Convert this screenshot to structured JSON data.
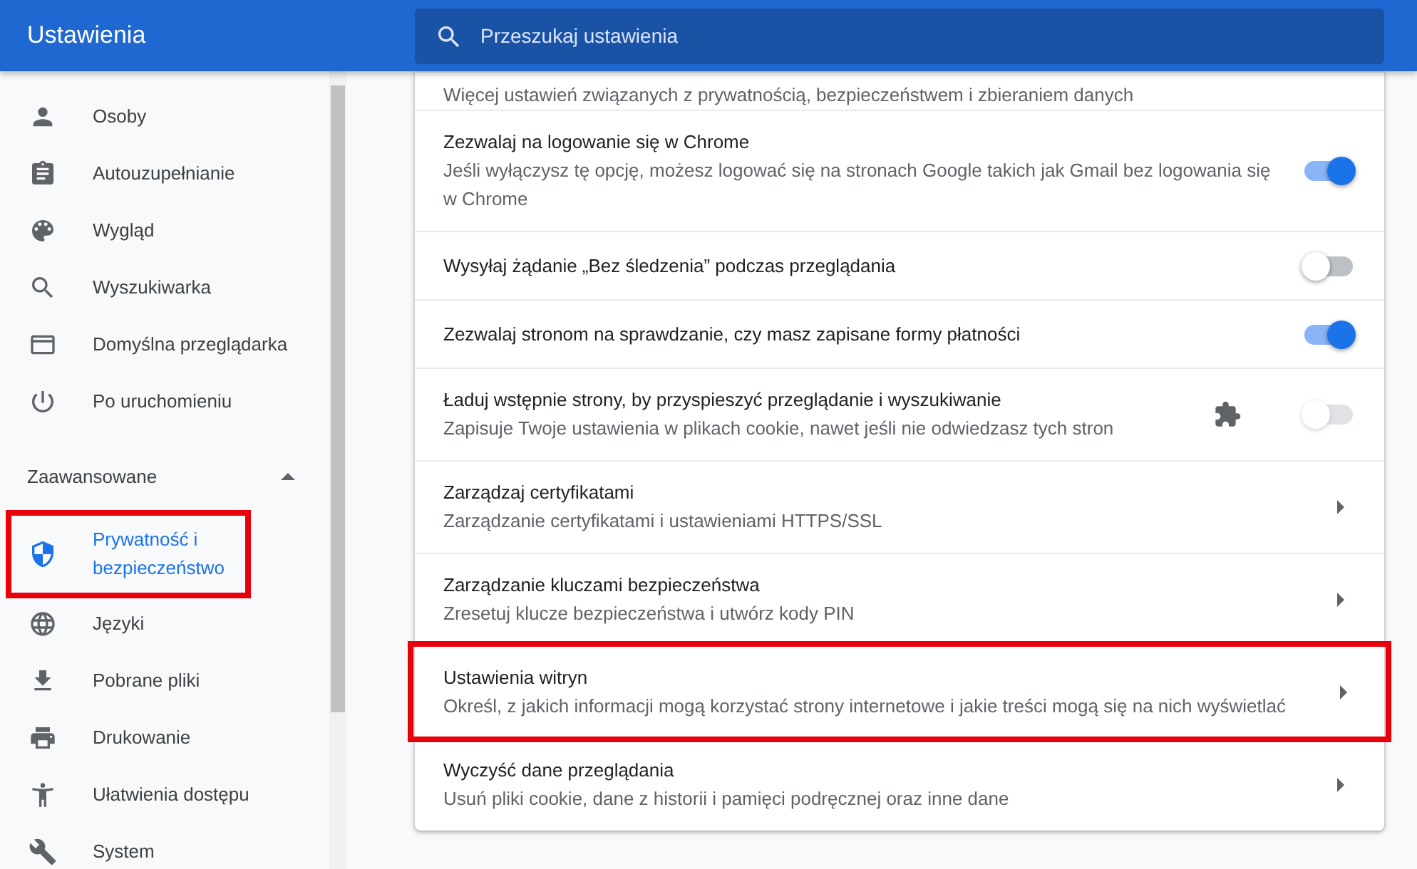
{
  "header": {
    "title": "Ustawienia",
    "search": {
      "placeholder": "Przeszukaj ustawienia"
    }
  },
  "sidebar": {
    "items": [
      {
        "label": "Osoby",
        "selected": false,
        "highlighted": false
      },
      {
        "label": "Autouzupełnianie",
        "selected": false,
        "highlighted": false
      },
      {
        "label": "Wygląd",
        "selected": false,
        "highlighted": false
      },
      {
        "label": "Wyszukiwarka",
        "selected": false,
        "highlighted": false
      },
      {
        "label": "Domyślna przeglądarka",
        "selected": false,
        "highlighted": false
      },
      {
        "label": "Po uruchomieniu",
        "selected": false,
        "highlighted": false
      }
    ],
    "advanced": {
      "label": "Zaawansowane",
      "expanded": true,
      "items": [
        {
          "label": "Prywatność i bezpieczeństwo",
          "selected": true,
          "highlighted": true
        },
        {
          "label": "Języki",
          "selected": false,
          "highlighted": false
        },
        {
          "label": "Pobrane pliki",
          "selected": false,
          "highlighted": false
        },
        {
          "label": "Drukowanie",
          "selected": false,
          "highlighted": false
        },
        {
          "label": "Ułatwienia dostępu",
          "selected": false,
          "highlighted": false
        },
        {
          "label": "System",
          "selected": false,
          "highlighted": false
        }
      ]
    }
  },
  "settings": [
    {
      "kind": "partial",
      "subtitle": "Więcej ustawień związanych z prywatnością, bezpieczeństwem i zbieraniem danych"
    },
    {
      "kind": "toggle",
      "title": "Zezwalaj na logowanie się w Chrome",
      "subtitle": "Jeśli wyłączysz tę opcję, możesz logować się na stronach Google takich jak Gmail bez logowania się w Chrome",
      "on": true,
      "disabled": false,
      "extension": false,
      "highlighted": false
    },
    {
      "kind": "toggle",
      "title": "Wysyłaj żądanie „Bez śledzenia” podczas przeglądania",
      "on": false,
      "disabled": false,
      "extension": false,
      "highlighted": false
    },
    {
      "kind": "toggle",
      "title": "Zezwalaj stronom na sprawdzanie, czy masz zapisane formy płatności",
      "on": true,
      "disabled": false,
      "extension": false,
      "highlighted": false
    },
    {
      "kind": "toggle",
      "title": "Ładuj wstępnie strony, by przyspieszyć przeglądanie i wyszukiwanie",
      "subtitle": "Zapisuje Twoje ustawienia w plikach cookie, nawet jeśli nie odwiedzasz tych stron",
      "on": false,
      "disabled": true,
      "extension": true,
      "highlighted": false
    },
    {
      "kind": "link",
      "title": "Zarządzaj certyfikatami",
      "subtitle": "Zarządzanie certyfikatami i ustawieniami HTTPS/SSL",
      "highlighted": false
    },
    {
      "kind": "link",
      "title": "Zarządzanie kluczami bezpieczeństwa",
      "subtitle": "Zresetuj klucze bezpieczeństwa i utwórz kody PIN",
      "highlighted": false
    },
    {
      "kind": "link",
      "title": "Ustawienia witryn",
      "subtitle": "Określ, z jakich informacji mogą korzystać strony internetowe i jakie treści mogą się na nich wyświetlać",
      "highlighted": true
    },
    {
      "kind": "link",
      "title": "Wyczyść dane przeglądania",
      "subtitle": "Usuń pliki cookie, dane z historii i pamięci podręcznej oraz inne dane",
      "highlighted": false
    }
  ]
}
